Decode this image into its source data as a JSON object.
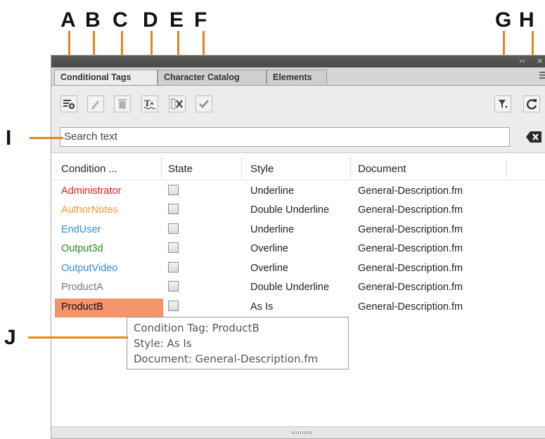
{
  "callouts": [
    "A",
    "B",
    "C",
    "D",
    "E",
    "F",
    "G",
    "H",
    "I",
    "J"
  ],
  "panel": {
    "collapse_glyph": "‹‹",
    "close_glyph": "×",
    "tabs": [
      "Conditional Tags",
      "Character Catalog",
      "Elements"
    ]
  },
  "toolbar": {
    "icons": [
      "new-tag-icon",
      "edit-tag-icon",
      "delete-tag-icon",
      "apply-tag-icon",
      "remove-tag-icon",
      "apply-check-icon",
      "filter-icon",
      "refresh-icon"
    ]
  },
  "search": {
    "placeholder": "Search text"
  },
  "table": {
    "headers": [
      "Condition ...",
      "State",
      "Style",
      "Document"
    ],
    "rows": [
      {
        "name": "Administrator",
        "color": "#e0201b",
        "style": "Underline",
        "document": "General-Description.fm"
      },
      {
        "name": "AuthorNotes",
        "color": "#f39a1e",
        "style": "Double Underline",
        "document": "General-Description.fm"
      },
      {
        "name": "EndUser",
        "color": "#2f8fde",
        "style": "Underline",
        "document": "General-Description.fm"
      },
      {
        "name": "Output3d",
        "color": "#1f8f1f",
        "style": "Overline",
        "document": "General-Description.fm"
      },
      {
        "name": "OutputVideo",
        "color": "#2f8fde",
        "style": "Overline",
        "document": "General-Description.fm"
      },
      {
        "name": "ProductA",
        "color": "#777777",
        "style": "Double Underline",
        "document": "General-Description.fm"
      },
      {
        "name": "ProductB",
        "color": "#111111",
        "style": "As Is",
        "document": "General-Description.fm"
      }
    ]
  },
  "tooltip": {
    "line1": "Condition Tag: ProductB",
    "line2": "Style: As Is",
    "line3": "Document: General-Description.fm"
  },
  "accent": "#e3851a",
  "selection_color": "#f4946a"
}
